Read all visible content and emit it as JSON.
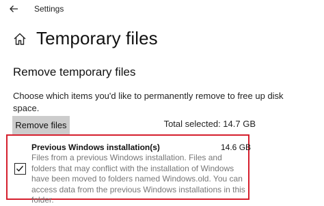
{
  "window": {
    "title": "Settings"
  },
  "page": {
    "title": "Temporary files"
  },
  "section": {
    "title": "Remove temporary files",
    "description": "Choose which items you'd like to permanently remove to free up disk space."
  },
  "actions": {
    "remove_label": "Remove files",
    "total_selected": "Total selected: 14.7 GB"
  },
  "items": [
    {
      "name": "Previous Windows installation(s)",
      "size": "14.6 GB",
      "checked": true,
      "description": "Files from a previous Windows installation.  Files and folders that may conflict with the installation of Windows have been moved to folders named Windows.old.  You can access data from the previous Windows installations in this folder."
    }
  ],
  "icons": {
    "back": "back-arrow-icon",
    "home": "home-icon",
    "check": "checkmark-icon"
  },
  "colors": {
    "highlight_border": "#d51e2c",
    "button_bg": "#cccccc",
    "secondary_text": "#767676"
  }
}
